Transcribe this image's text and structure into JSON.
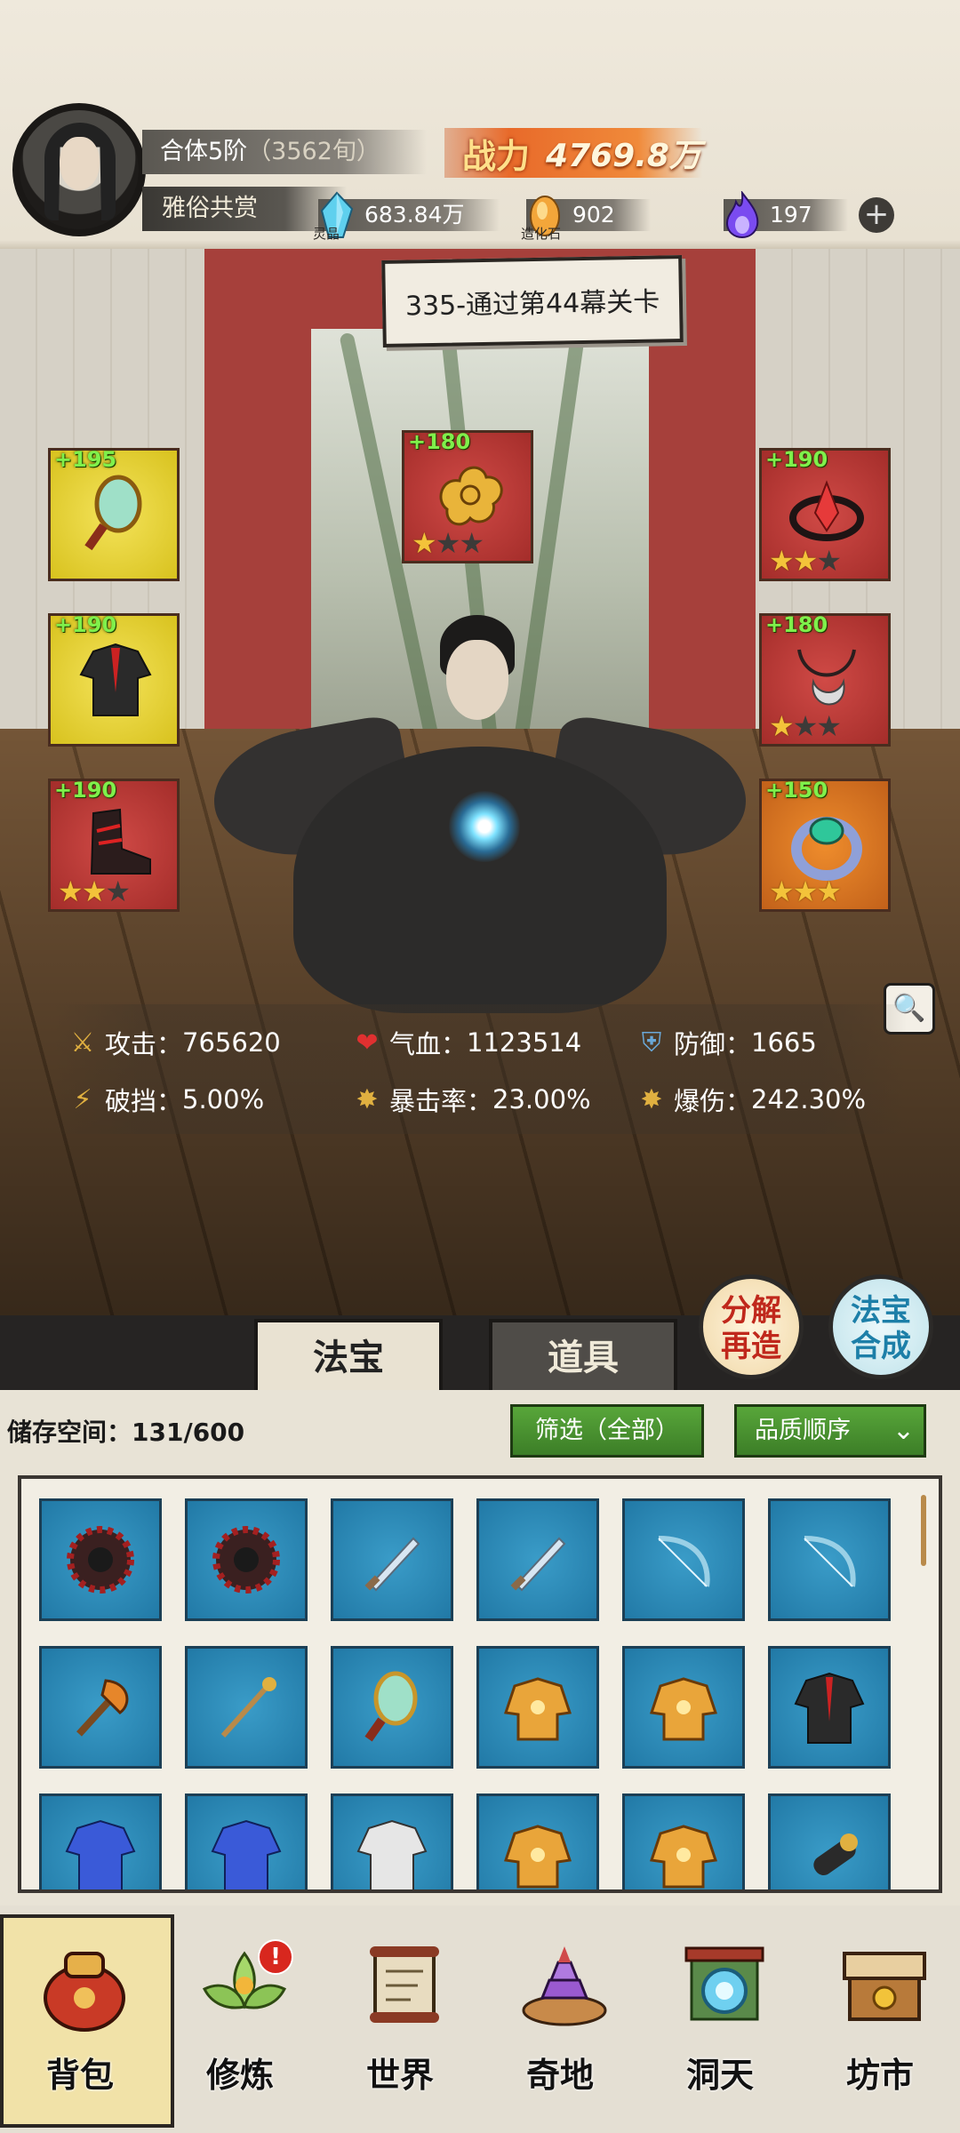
{
  "player": {
    "realm": "合体5阶",
    "realm_detail": "（3562旬）",
    "nickname": "雅俗共赏",
    "power_label": "战力",
    "power_value": "4769.8万"
  },
  "resources": [
    {
      "icon": "spirit-crystal-icon",
      "caption": "灵晶",
      "value": "683.84万"
    },
    {
      "icon": "creation-stone-icon",
      "caption": "造化石",
      "value": "902"
    },
    {
      "icon": "purple-flame-icon",
      "caption": "",
      "value": "197"
    }
  ],
  "stage": {
    "label": "335-通过第44幕关卡"
  },
  "equipment": [
    {
      "slot": "left-1",
      "bonus": "+195",
      "stars": 0,
      "quality": "yellow",
      "icon": "mirror-icon"
    },
    {
      "slot": "left-2",
      "bonus": "+190",
      "stars": 0,
      "quality": "yellow",
      "icon": "robe-icon"
    },
    {
      "slot": "left-3",
      "bonus": "+190",
      "stars": 2,
      "quality": "red",
      "icon": "boots-icon"
    },
    {
      "slot": "top",
      "bonus": "+180",
      "stars": 1,
      "quality": "red",
      "icon": "cloud-pendant-icon"
    },
    {
      "slot": "right-1",
      "bonus": "+190",
      "stars": 2,
      "quality": "red",
      "icon": "crown-icon"
    },
    {
      "slot": "right-2",
      "bonus": "+180",
      "stars": 1,
      "quality": "red",
      "icon": "necklace-icon"
    },
    {
      "slot": "right-3",
      "bonus": "+150",
      "stars": 3,
      "quality": "orange",
      "icon": "ring-icon"
    }
  ],
  "stats": {
    "attack": {
      "label": "攻击：",
      "value": "765620"
    },
    "hp": {
      "label": "气血：",
      "value": "1123514"
    },
    "defense": {
      "label": "防御：",
      "value": "1665"
    },
    "break": {
      "label": "破挡：",
      "value": "5.00%"
    },
    "crit_rate": {
      "label": "暴击率：",
      "value": "23.00%"
    },
    "crit_dmg": {
      "label": "爆伤：",
      "value": "242.30%"
    }
  },
  "buttons": {
    "decompose": [
      "分解",
      "再造"
    ],
    "compose": [
      "法宝",
      "合成"
    ]
  },
  "tabs": {
    "fabao": "法宝",
    "daoju": "道具"
  },
  "inventory": {
    "storage_label": "储存空间：",
    "storage_value": "131/600",
    "filter_label": "筛选（全部）",
    "sort_label": "品质顺序",
    "items": [
      "spiked-wheel-icon",
      "spiked-wheel-icon",
      "sword-icon",
      "sword-icon",
      "bow-icon",
      "bow-icon",
      "axe-icon",
      "staff-icon",
      "mirror-icon",
      "golden-armor-icon",
      "golden-armor-icon",
      "robe-icon",
      "blue-robe-icon",
      "blue-robe-icon",
      "white-armor-icon",
      "golden-armor-icon",
      "golden-armor-icon",
      "scroll-tube-icon"
    ]
  },
  "nav": [
    {
      "label": "背包",
      "icon": "bag-icon",
      "selected": true
    },
    {
      "label": "修炼",
      "icon": "lotus-icon",
      "badge": "!"
    },
    {
      "label": "世界",
      "icon": "scroll-map-icon"
    },
    {
      "label": "奇地",
      "icon": "pagoda-icon"
    },
    {
      "label": "洞天",
      "icon": "portal-icon"
    },
    {
      "label": "坊市",
      "icon": "shop-icon"
    }
  ]
}
